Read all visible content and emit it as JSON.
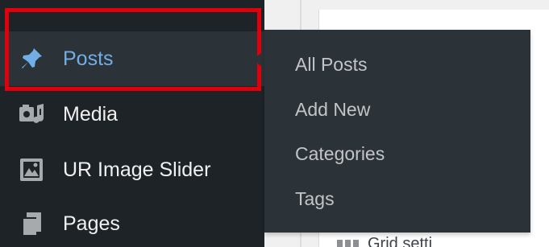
{
  "sidebar": {
    "items": [
      {
        "label": "Posts",
        "icon": "pushpin-icon",
        "active": true
      },
      {
        "label": "Media",
        "icon": "media-icon",
        "active": false
      },
      {
        "label": "UR Image Slider",
        "icon": "image-icon",
        "active": false
      },
      {
        "label": "Pages",
        "icon": "pages-icon",
        "active": false
      }
    ]
  },
  "submenu": {
    "items": [
      {
        "label": "All Posts"
      },
      {
        "label": "Add New"
      },
      {
        "label": "Categories"
      },
      {
        "label": "Tags"
      }
    ]
  },
  "background": {
    "partial_text": "Grid setti"
  },
  "colors": {
    "sidebar_bg": "#1d2327",
    "active_bg": "#2c3338",
    "active_text": "#72aee6",
    "highlight": "#e0000b",
    "submenu_text": "#c3c4c7"
  }
}
